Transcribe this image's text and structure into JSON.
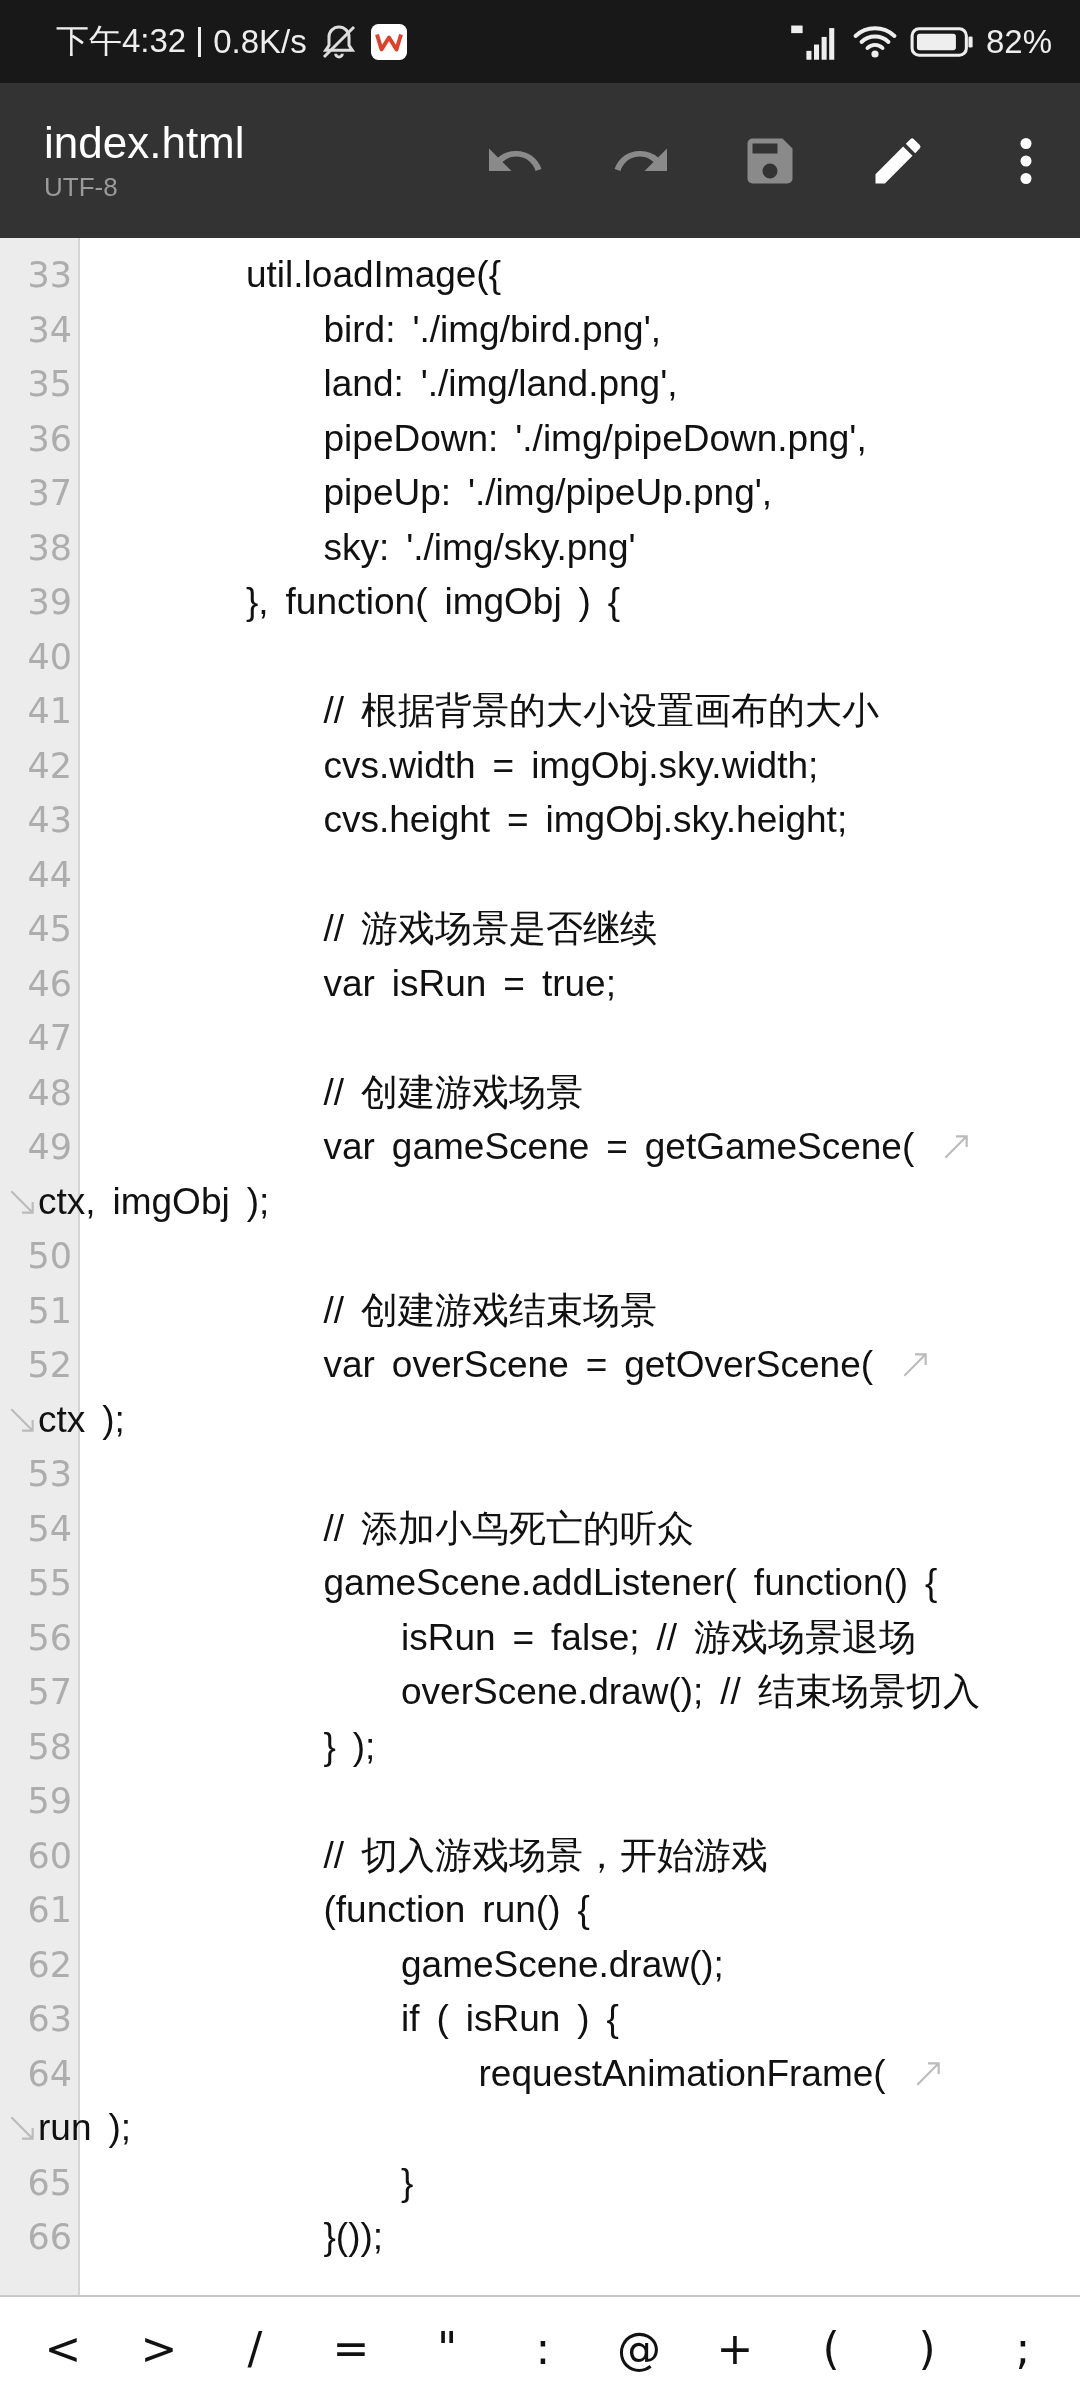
{
  "status_bar": {
    "time": "下午4:32",
    "speed": "0.8K/s",
    "battery": "82%"
  },
  "toolbar": {
    "title": "index.html",
    "encoding": "UTF-8",
    "actions": [
      {
        "kind": "undo",
        "disabled": true
      },
      {
        "kind": "redo",
        "disabled": true
      },
      {
        "kind": "save",
        "disabled": true
      },
      {
        "kind": "edit",
        "disabled": false
      },
      {
        "kind": "more",
        "disabled": false
      }
    ]
  },
  "editor": {
    "lines": [
      {
        "num": "33",
        "text": "\t\tutil.loadImage({"
      },
      {
        "num": "34",
        "text": "\t\t\tbird: './img/bird.png',"
      },
      {
        "num": "35",
        "text": "\t\t\tland: './img/land.png',"
      },
      {
        "num": "36",
        "text": "\t\t\tpipeDown: './img/pipeDown.png',"
      },
      {
        "num": "37",
        "text": "\t\t\tpipeUp: './img/pipeUp.png',"
      },
      {
        "num": "38",
        "text": "\t\t\tsky: './img/sky.png'"
      },
      {
        "num": "39",
        "text": "\t\t}, function( imgObj ) {"
      },
      {
        "num": "40"
      },
      {
        "num": "41",
        "text": "\t\t\t// 根据背景的大小设置画布的大小"
      },
      {
        "num": "42",
        "text": "\t\t\tcvs.width = imgObj.sky.width;"
      },
      {
        "num": "43",
        "text": "\t\t\tcvs.height = imgObj.sky.height;"
      },
      {
        "num": "44"
      },
      {
        "num": "45",
        "text": "\t\t\t// 游戏场景是否继续"
      },
      {
        "num": "46",
        "text": "\t\t\tvar isRun = true;"
      },
      {
        "num": "47"
      },
      {
        "num": "48",
        "text": "\t\t\t// 创建游戏场景"
      },
      {
        "num": "49",
        "text": "\t\t\tvar gameScene = getGameScene(",
        "wrap": "ctx, imgObj );"
      },
      {
        "num": "50"
      },
      {
        "num": "51",
        "text": "\t\t\t// 创建游戏结束场景"
      },
      {
        "num": "52",
        "text": "\t\t\tvar overScene = getOverScene(",
        "wrap": "ctx );"
      },
      {
        "num": "53"
      },
      {
        "num": "54",
        "text": "\t\t\t// 添加小鸟死亡的听众"
      },
      {
        "num": "55",
        "text": "\t\t\tgameScene.addListener( function() {"
      },
      {
        "num": "56",
        "text": "\t\t\t\tisRun = false; // 游戏场景退场"
      },
      {
        "num": "57",
        "text": "\t\t\t\toverScene.draw(); // 结束场景切入"
      },
      {
        "num": "58",
        "text": "\t\t\t} );"
      },
      {
        "num": "59"
      },
      {
        "num": "60",
        "text": "\t\t\t// 切入游戏场景，开始游戏"
      },
      {
        "num": "61",
        "text": "\t\t\t(function run() {"
      },
      {
        "num": "62",
        "text": "\t\t\t\tgameScene.draw();"
      },
      {
        "num": "63",
        "text": "\t\t\t\tif ( isRun ) {"
      },
      {
        "num": "64",
        "text": "\t\t\t\t\trequestAnimationFrame(",
        "wrap": "run );"
      },
      {
        "num": "65",
        "text": "\t\t\t\t}"
      },
      {
        "num": "66",
        "text": "\t\t\t}());"
      }
    ]
  },
  "symbol_keys": [
    "<",
    ">",
    "/",
    "=",
    "\"",
    ":",
    "@",
    "+",
    "(",
    ")",
    ";"
  ]
}
